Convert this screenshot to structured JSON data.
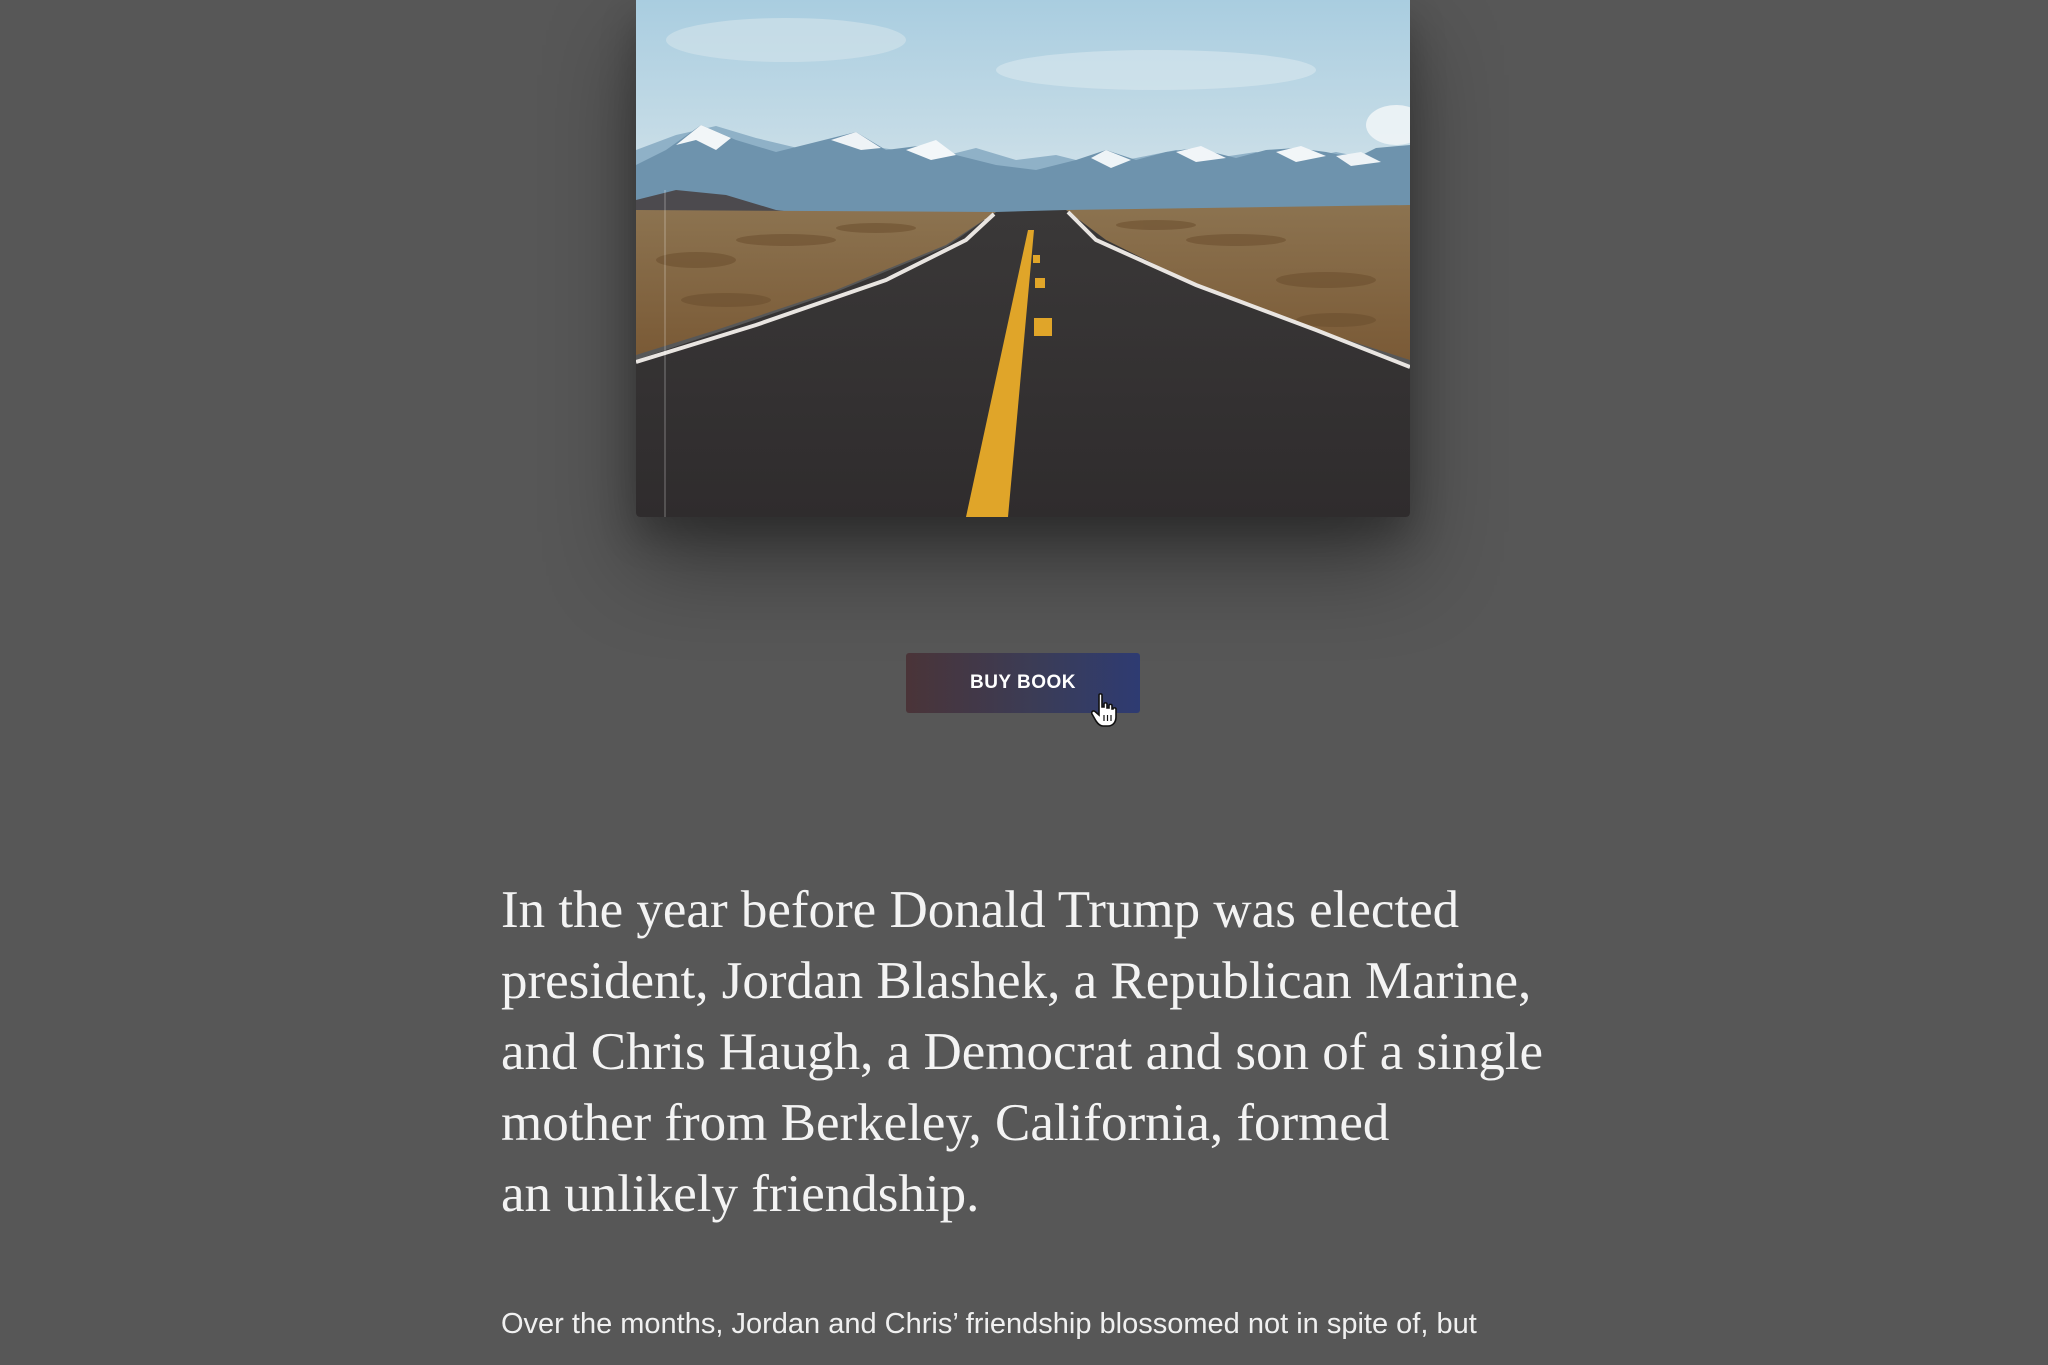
{
  "book": {
    "cover_image": "desert-road-mountains-illustration"
  },
  "cta": {
    "buy_label": "BUY BOOK"
  },
  "intro": {
    "lines": [
      "In the year before Donald Trump was elected",
      "president, Jordan Blashek, a Republican Marine,",
      "and Chris Haugh, a Democrat and son of a single",
      "mother from Berkeley, California, formed",
      "an unlikely friendship."
    ]
  },
  "body": {
    "paragraph_start": "Over the months, Jordan and Chris’ friendship blossomed not in spite of, but"
  },
  "colors": {
    "background": "#575757",
    "button_start": "#4a3438",
    "button_end": "#2e3b72",
    "text": "#f3f3f3"
  }
}
